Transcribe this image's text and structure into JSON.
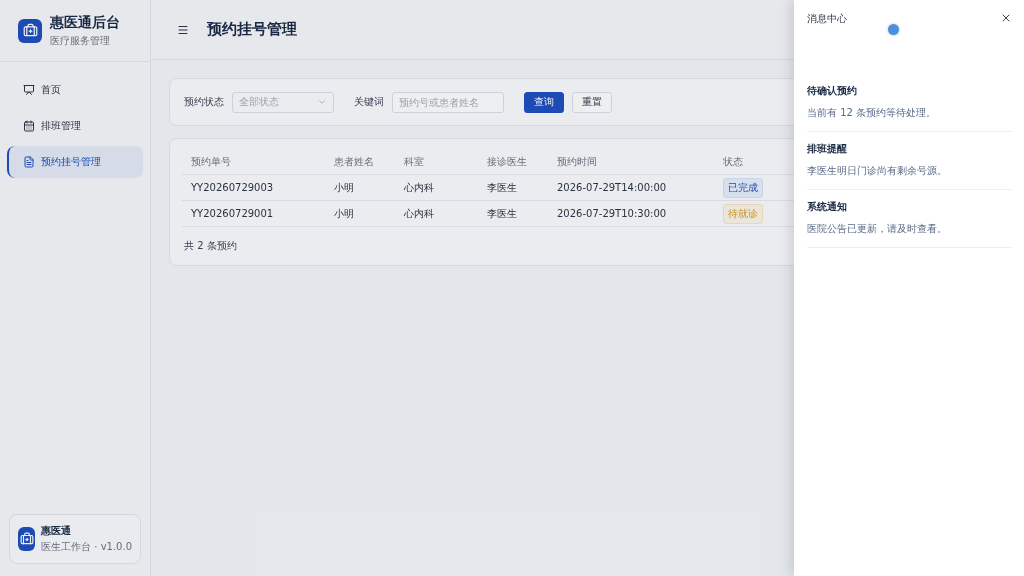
{
  "brand": {
    "title": "惠医通后台",
    "subtitle": "医疗服务管理"
  },
  "nav": [
    {
      "label": "首页",
      "selected": false
    },
    {
      "label": "排班管理",
      "selected": false
    },
    {
      "label": "预约挂号管理",
      "selected": true
    }
  ],
  "sidebar_footer": {
    "title": "惠医通",
    "subtitle": "医生工作台 · v1.0.0"
  },
  "header": {
    "title": "预约挂号管理"
  },
  "filters": {
    "status_label": "预约状态",
    "status_placeholder": "全部状态",
    "keyword_label": "关键词",
    "keyword_placeholder": "预约号或患者姓名",
    "search_button": "查询",
    "reset_button": "重置"
  },
  "table": {
    "columns": [
      "预约单号",
      "患者姓名",
      "科室",
      "接诊医生",
      "预约时间",
      "状态"
    ],
    "rows": [
      {
        "cells": [
          "YY20260729003",
          "小明",
          "心内科",
          "李医生",
          "2026-07-29T14:00:00"
        ],
        "status": {
          "label": "已完成",
          "kind": "done"
        }
      },
      {
        "cells": [
          "YY20260729001",
          "小明",
          "心内科",
          "李医生",
          "2026-07-29T10:30:00"
        ],
        "status": {
          "label": "待就诊",
          "kind": "pending"
        }
      }
    ],
    "footer": "共 2 条预约"
  },
  "drawer": {
    "title": "消息中心",
    "messages": [
      {
        "title": "待确认预约",
        "body": "当前有 12 条预约等待处理。"
      },
      {
        "title": "排班提醒",
        "body": "李医生明日门诊尚有剩余号源。"
      },
      {
        "title": "系统通知",
        "body": "医院公告已更新，请及时查看。"
      }
    ]
  }
}
